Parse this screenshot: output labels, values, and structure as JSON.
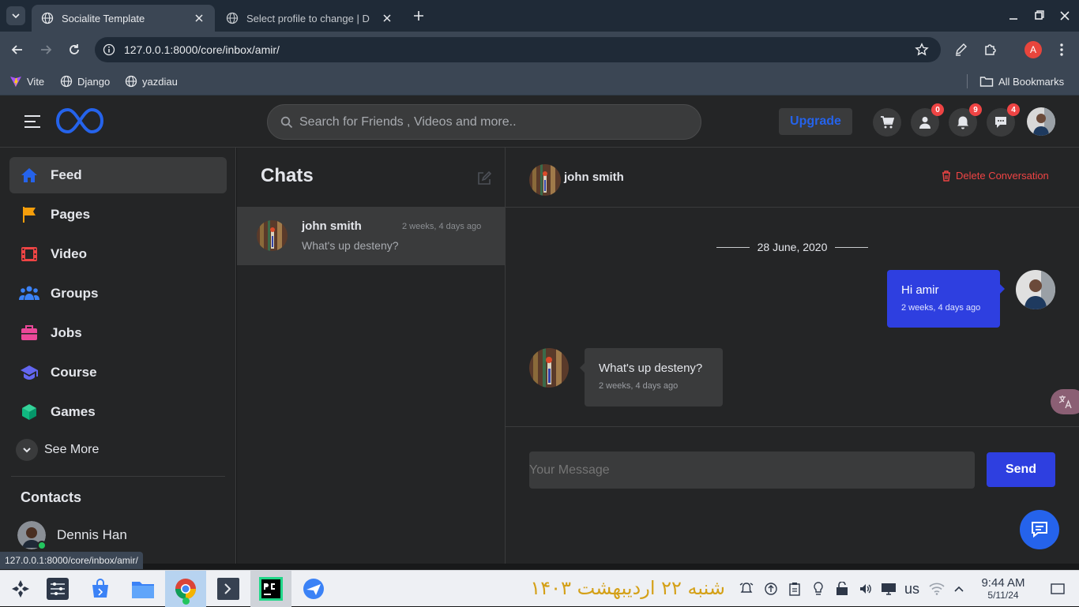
{
  "browser": {
    "tabs": [
      {
        "title": "Socialite Template",
        "active": true
      },
      {
        "title": "Select profile to change | D",
        "active": false
      }
    ],
    "url": "127.0.0.1:8000/core/inbox/amir/",
    "bookmarks": [
      "Vite",
      "Django",
      "yazdiau"
    ],
    "all_bookmarks": "All Bookmarks",
    "profile_initial": "A",
    "status_url": "127.0.0.1:8000/core/inbox/amir/"
  },
  "header": {
    "search_placeholder": "Search for Friends , Videos and more..",
    "upgrade_label": "Upgrade",
    "badges": {
      "friends": "0",
      "notifications": "9",
      "messages": "4"
    }
  },
  "sidebar": {
    "items": [
      {
        "label": "Feed",
        "icon": "home-icon",
        "color": "#2563eb"
      },
      {
        "label": "Pages",
        "icon": "flag-icon",
        "color": "#f59e0b"
      },
      {
        "label": "Video",
        "icon": "film-icon",
        "color": "#ef4444"
      },
      {
        "label": "Groups",
        "icon": "users-icon",
        "color": "#3b82f6"
      },
      {
        "label": "Jobs",
        "icon": "briefcase-icon",
        "color": "#ec4899"
      },
      {
        "label": "Course",
        "icon": "graduation-cap-icon",
        "color": "#6366f1"
      },
      {
        "label": "Games",
        "icon": "cube-icon",
        "color": "#10b981"
      }
    ],
    "see_more": "See More",
    "contacts_title": "Contacts",
    "contacts": [
      {
        "name": "Dennis Han",
        "online": true
      }
    ]
  },
  "chats": {
    "title": "Chats",
    "items": [
      {
        "name": "john smith",
        "time": "2 weeks, 4 days ago",
        "preview": "What's up desteny?"
      }
    ]
  },
  "conversation": {
    "partner_name": "john smith",
    "delete_label": "Delete Conversation",
    "date_divider": "28 June, 2020",
    "messages": [
      {
        "direction": "sent",
        "text": "Hi amir",
        "time": "2 weeks, 4 days ago"
      },
      {
        "direction": "received",
        "text": "What's up desteny?",
        "time": "2 weeks, 4 days ago"
      }
    ],
    "input_placeholder": "Your Message",
    "send_label": "Send"
  },
  "taskbar": {
    "date_persian": "شنبه ۲۲ اردیبهشت ۱۴۰۳",
    "keyboard_layout": "us",
    "time": "9:44 AM",
    "date": "5/11/24"
  },
  "colors": {
    "accent": "#2563eb",
    "sent_bubble": "#2e3fe0",
    "received_bubble": "#3a3b3c",
    "delete": "#ef4444",
    "badge": "#ef4444"
  }
}
